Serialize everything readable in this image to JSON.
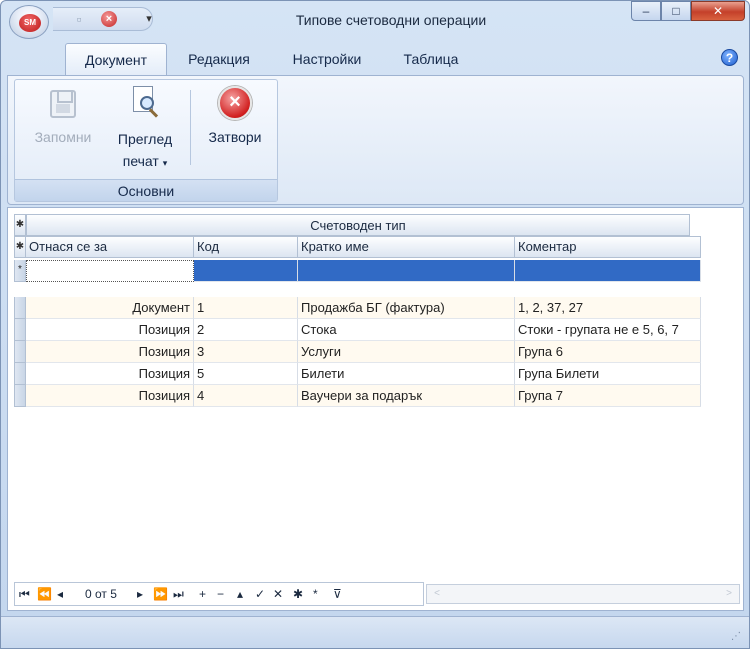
{
  "window": {
    "title": "Типове счетоводни операции",
    "app_logo_text": "SM",
    "controls": {
      "minimize": "‒",
      "maximize": "□",
      "close": "✕"
    }
  },
  "qat": {
    "save_icon": "floppy-icon",
    "close_icon": "close-icon",
    "dropdown": "▾"
  },
  "tabs": [
    {
      "label": "Документ",
      "active": true
    },
    {
      "label": "Редакция",
      "active": false
    },
    {
      "label": "Настройки",
      "active": false
    },
    {
      "label": "Таблица",
      "active": false
    }
  ],
  "help": "?",
  "ribbon": {
    "group_label": "Основни",
    "save": {
      "label": "Запомни",
      "enabled": false
    },
    "preview": {
      "line1": "Преглед",
      "line2": "печат",
      "caret": "▾"
    },
    "close": {
      "label": "Затвори"
    }
  },
  "grid": {
    "band_title": "Счетоводен тип",
    "columns": [
      "Отнася се за",
      "Код",
      "Кратко име",
      "Коментар"
    ],
    "new_row_marker": "*",
    "rows": [
      {
        "applies_to": "Документ",
        "code": "1",
        "short_name": "Продажба БГ (фактура)",
        "comment": "1, 2, 37, 27"
      },
      {
        "applies_to": "Позиция",
        "code": "2",
        "short_name": "Стока",
        "comment": "Стоки - групата не е 5, 6, 7"
      },
      {
        "applies_to": "Позиция",
        "code": "3",
        "short_name": "Услуги",
        "comment": "Група 6"
      },
      {
        "applies_to": "Позиция",
        "code": "5",
        "short_name": "Билети",
        "comment": "Група Билети"
      },
      {
        "applies_to": "Позиция",
        "code": "4",
        "short_name": "Ваучери за подарък",
        "comment": "Група 7"
      }
    ]
  },
  "navigator": {
    "first": "⏮",
    "prev_page": "⏪",
    "prev": "◂",
    "record_text": "0 от 5",
    "next": "▸",
    "next_page": "⏩",
    "last": "⏭",
    "insert": "+",
    "delete": "−",
    "edit": "▴",
    "post": "✓",
    "cancel": "✕",
    "bookmark": "✱",
    "goto_bookmark": "*",
    "filter": "⊽"
  },
  "scroll": {
    "left": "<",
    "right": ">"
  },
  "status_grip": "⋰"
}
